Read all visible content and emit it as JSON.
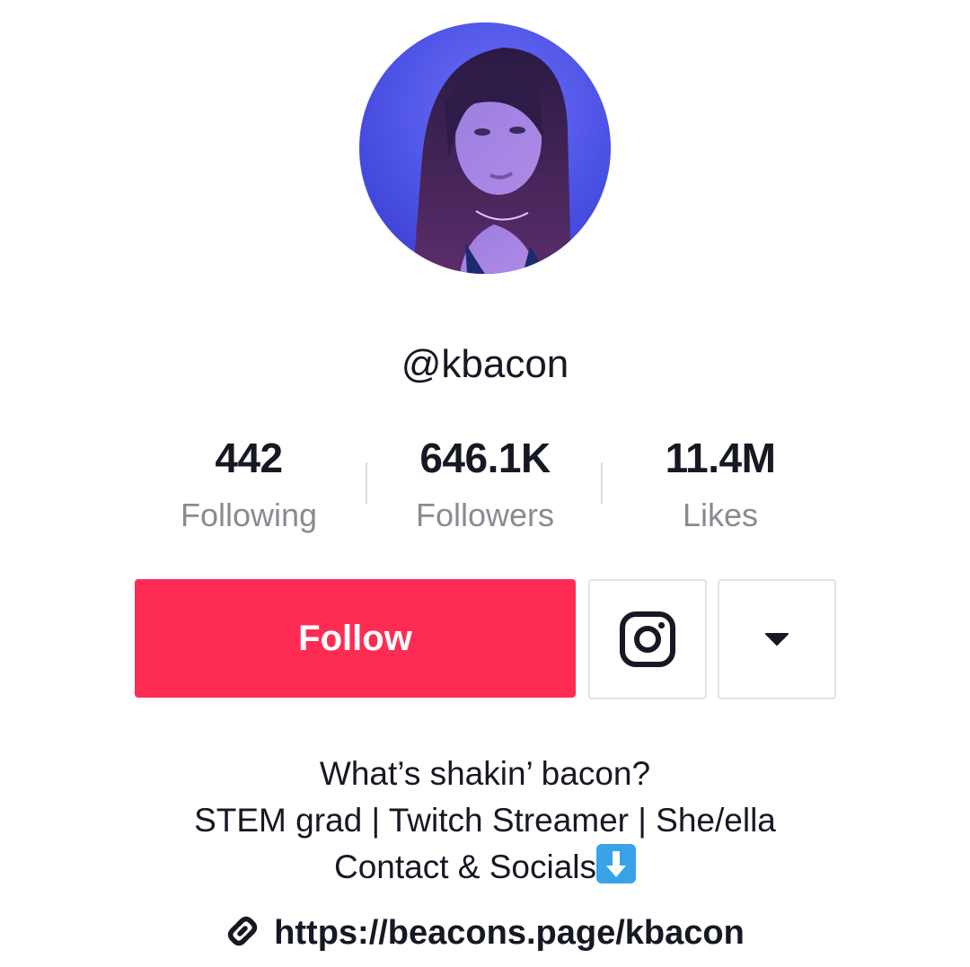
{
  "profile": {
    "username": "@kbacon",
    "avatar": "profile-photo"
  },
  "stats": [
    {
      "value": "442",
      "label": "Following"
    },
    {
      "value": "646.1K",
      "label": "Followers"
    },
    {
      "value": "11.4M",
      "label": "Likes"
    }
  ],
  "actions": {
    "follow_label": "Follow",
    "instagram_icon": "instagram-icon",
    "more_icon": "caret-down-icon"
  },
  "bio": {
    "line1": "What’s shakin’ bacon?",
    "line2": "STEM grad | Twitch Streamer | She/ella",
    "line3": "Contact & Socials",
    "line3_emoji": "down-arrow-emoji",
    "link": "https://beacons.page/kbacon",
    "link_icon": "link-icon"
  },
  "colors": {
    "follow_button": "#fe2c55",
    "secondary_text": "#8a8b91",
    "primary_text": "#161823",
    "emoji_blue": "#3aa2e8"
  }
}
